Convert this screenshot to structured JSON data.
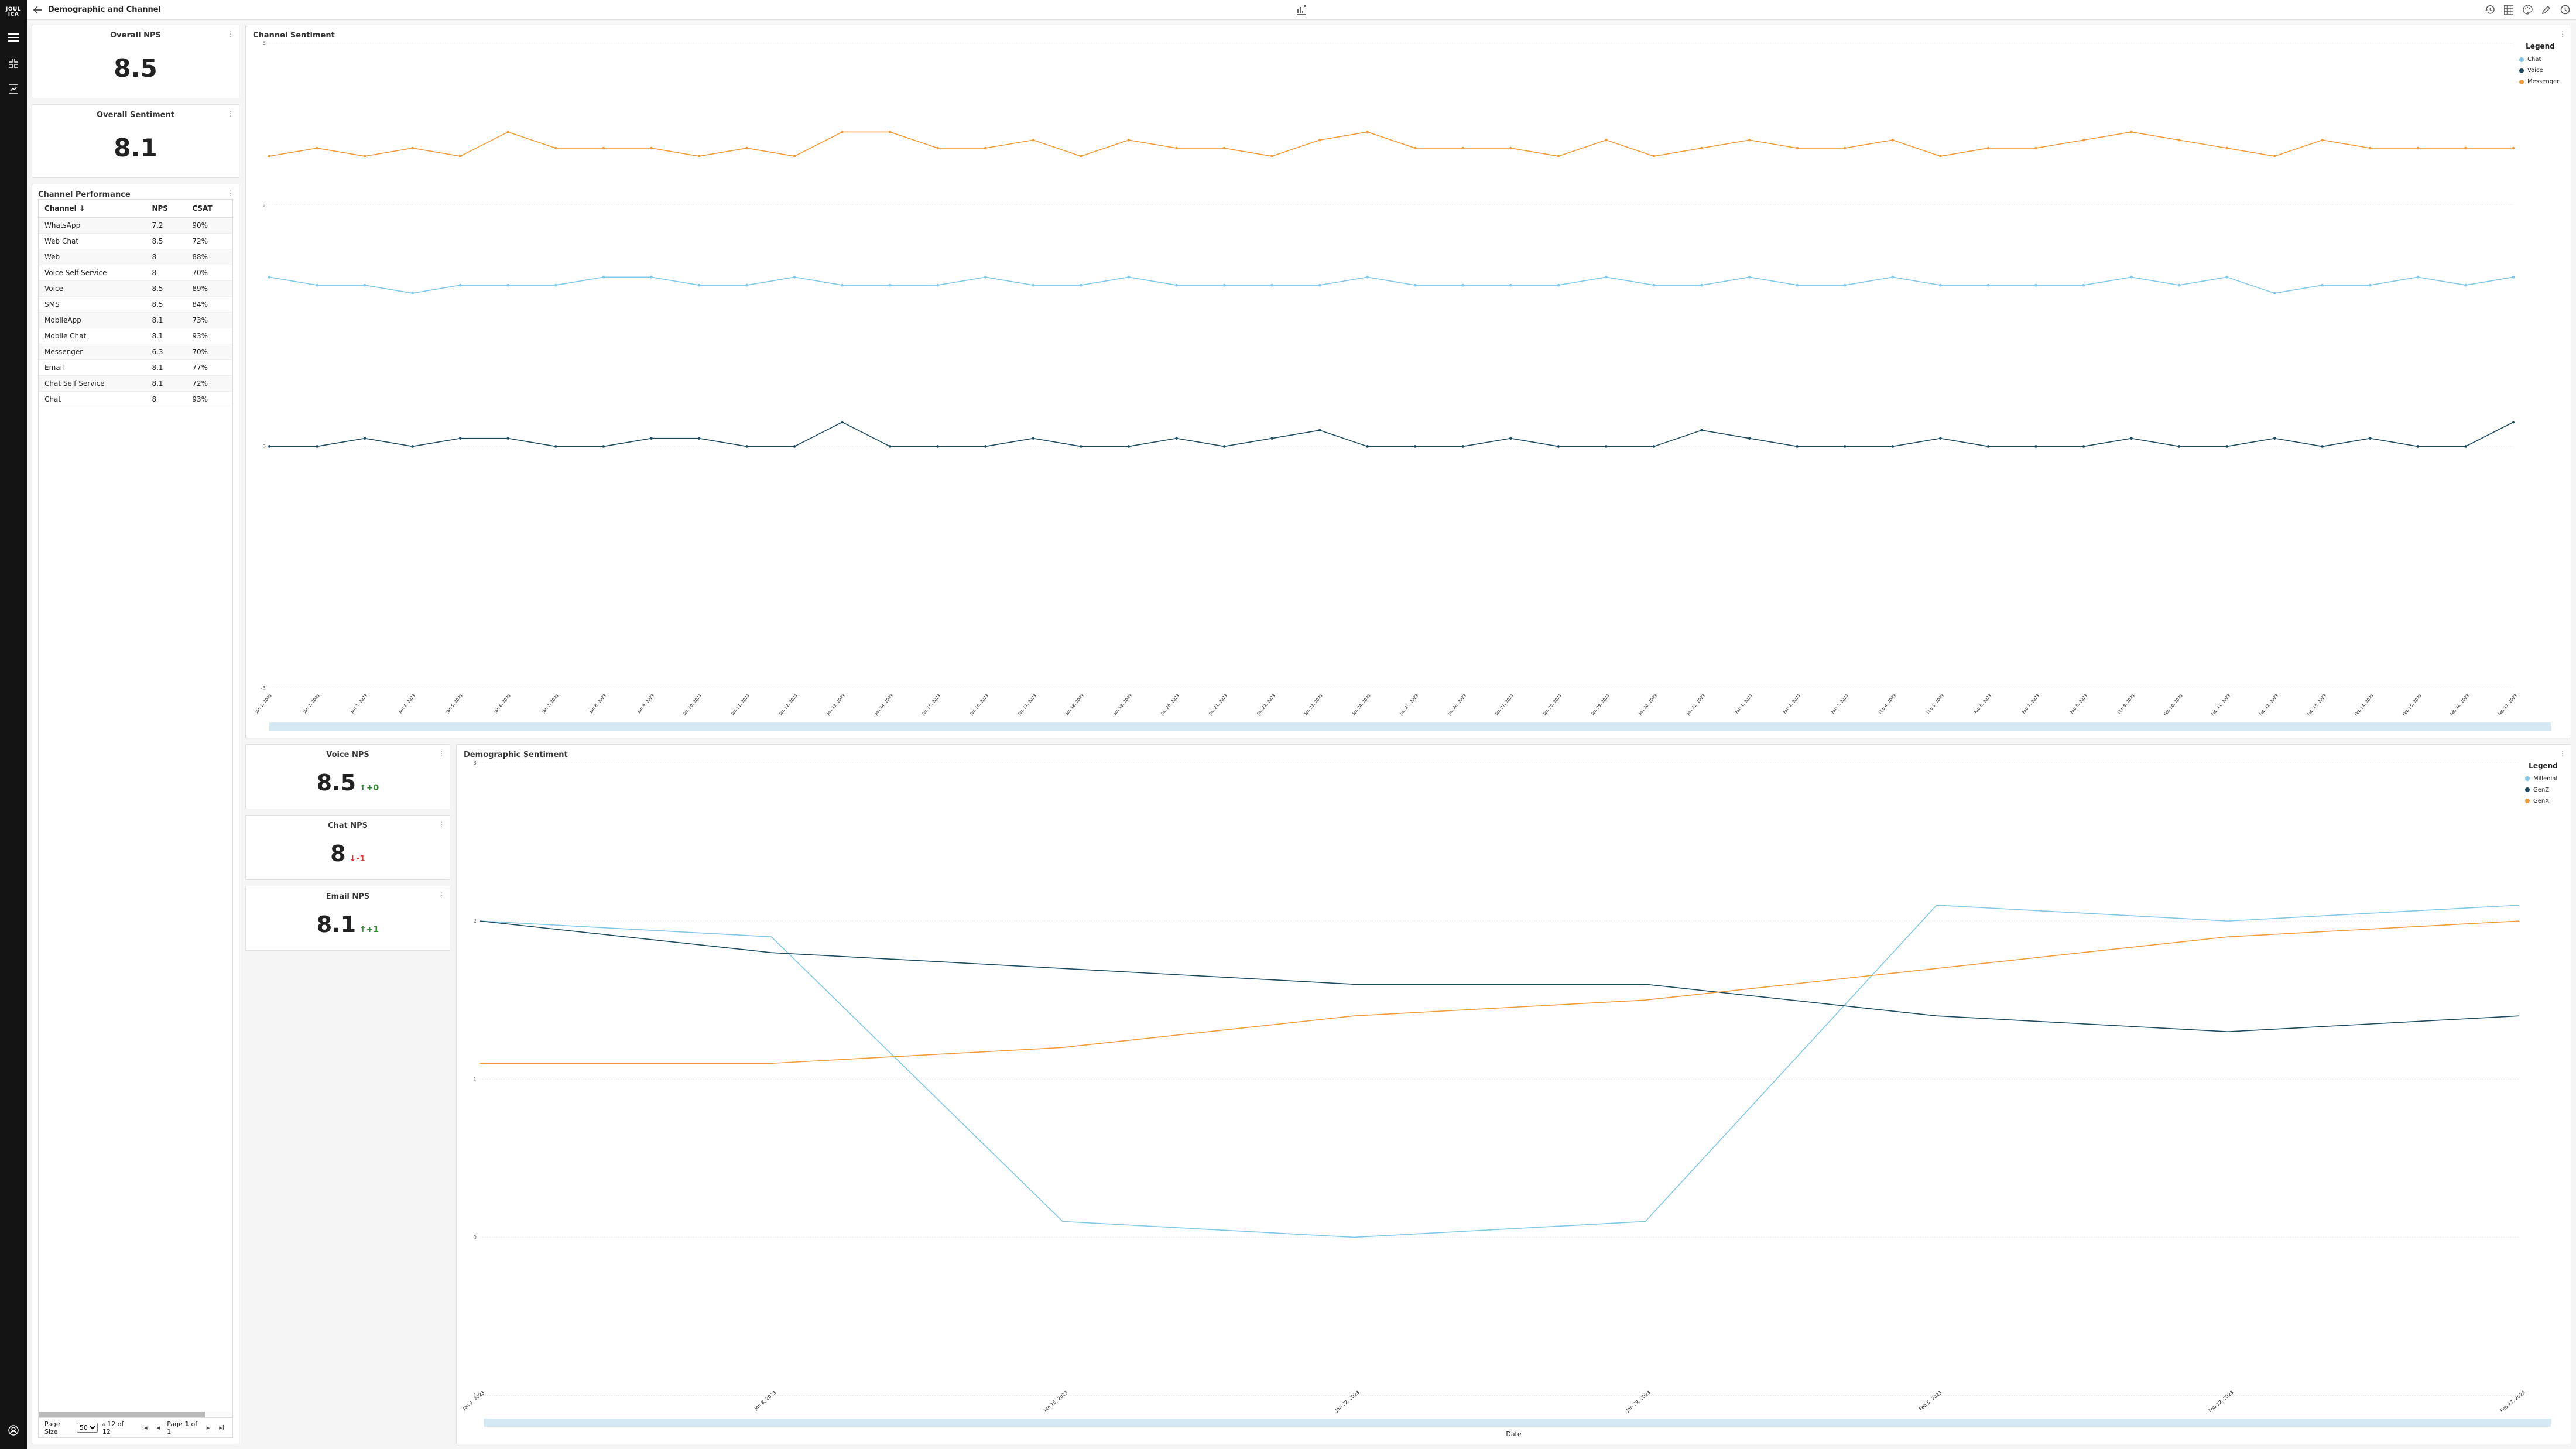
{
  "brand": "JOUL ICA",
  "header": {
    "title": "Demographic and Channel"
  },
  "overall_nps": {
    "title": "Overall NPS",
    "value": "8.5"
  },
  "overall_sentiment": {
    "title": "Overall Sentiment",
    "value": "8.1"
  },
  "channel_perf": {
    "title": "Channel Performance",
    "columns": {
      "c0": "Channel",
      "c1": "NPS",
      "c2": "CSAT"
    },
    "rows": [
      {
        "channel": "WhatsApp",
        "nps": "7.2",
        "csat": "90%"
      },
      {
        "channel": "Web Chat",
        "nps": "8.5",
        "csat": "72%"
      },
      {
        "channel": "Web",
        "nps": "8",
        "csat": "88%"
      },
      {
        "channel": "Voice Self Service",
        "nps": "8",
        "csat": "70%"
      },
      {
        "channel": "Voice",
        "nps": "8.5",
        "csat": "89%"
      },
      {
        "channel": "SMS",
        "nps": "8.5",
        "csat": "84%"
      },
      {
        "channel": "MobileApp",
        "nps": "8.1",
        "csat": "73%"
      },
      {
        "channel": "Mobile Chat",
        "nps": "8.1",
        "csat": "93%"
      },
      {
        "channel": "Messenger",
        "nps": "6.3",
        "csat": "70%"
      },
      {
        "channel": "Email",
        "nps": "8.1",
        "csat": "77%"
      },
      {
        "channel": "Chat Self Service",
        "nps": "8.1",
        "csat": "72%"
      },
      {
        "channel": "Chat",
        "nps": "8",
        "csat": "93%"
      }
    ],
    "pager": {
      "label": "Page Size",
      "pagesize": "50",
      "count": "12 of 12",
      "pageinfo": "Page 1 of 1"
    }
  },
  "channel_sentiment": {
    "title": "Channel Sentiment",
    "legend_title": "Legend",
    "legend": {
      "chat": "Chat",
      "voice": "Voice",
      "messenger": "Messenger"
    }
  },
  "voice_nps": {
    "title": "Voice NPS",
    "value": "8.5",
    "delta": "+0"
  },
  "chat_nps": {
    "title": "Chat NPS",
    "value": "8",
    "delta": "-1"
  },
  "email_nps": {
    "title": "Email NPS",
    "value": "8.1",
    "delta": "+1"
  },
  "demo_sentiment": {
    "title": "Demographic Sentiment",
    "legend_title": "Legend",
    "legend": {
      "millenial": "Millenial",
      "genz": "GenZ",
      "genx": "GenX"
    },
    "xlabel": "Date"
  },
  "chart_data": [
    {
      "id": "channel_sentiment",
      "type": "line",
      "title": "Channel Sentiment",
      "ylabel": "",
      "xlabel": "",
      "ylim": [
        -3,
        5
      ],
      "yticks": [
        -3,
        0,
        3,
        5
      ],
      "x": [
        "Jan 1, 2023",
        "Jan 2, 2023",
        "Jan 3, 2023",
        "Jan 4, 2023",
        "Jan 5, 2023",
        "Jan 6, 2023",
        "Jan 7, 2023",
        "Jan 8, 2023",
        "Jan 9, 2023",
        "Jan 10, 2023",
        "Jan 11, 2023",
        "Jan 12, 2023",
        "Jan 13, 2023",
        "Jan 14, 2023",
        "Jan 15, 2023",
        "Jan 16, 2023",
        "Jan 17, 2023",
        "Jan 18, 2023",
        "Jan 19, 2023",
        "Jan 20, 2023",
        "Jan 21, 2023",
        "Jan 22, 2023",
        "Jan 23, 2023",
        "Jan 24, 2023",
        "Jan 25, 2023",
        "Jan 26, 2023",
        "Jan 27, 2023",
        "Jan 28, 2023",
        "Jan 29, 2023",
        "Jan 30, 2023",
        "Jan 31, 2023",
        "Feb 1, 2023",
        "Feb 2, 2023",
        "Feb 3, 2023",
        "Feb 4, 2023",
        "Feb 5, 2023",
        "Feb 6, 2023",
        "Feb 7, 2023",
        "Feb 8, 2023",
        "Feb 9, 2023",
        "Feb 10, 2023",
        "Feb 11, 2023",
        "Feb 12, 2023",
        "Feb 13, 2023",
        "Feb 14, 2023",
        "Feb 15, 2023",
        "Feb 16, 2023",
        "Feb 17, 2023"
      ],
      "series": [
        {
          "name": "Messenger",
          "color": "#f19a36",
          "values": [
            3.6,
            3.7,
            3.6,
            3.7,
            3.6,
            3.9,
            3.7,
            3.7,
            3.7,
            3.6,
            3.7,
            3.6,
            3.9,
            3.9,
            3.7,
            3.7,
            3.8,
            3.6,
            3.8,
            3.7,
            3.7,
            3.6,
            3.8,
            3.9,
            3.7,
            3.7,
            3.7,
            3.6,
            3.8,
            3.6,
            3.7,
            3.8,
            3.7,
            3.7,
            3.8,
            3.6,
            3.7,
            3.7,
            3.8,
            3.9,
            3.8,
            3.7,
            3.6,
            3.8,
            3.7,
            3.7,
            3.7,
            3.7
          ]
        },
        {
          "name": "Chat",
          "color": "#7dc7e8",
          "values": [
            2.1,
            2.0,
            2.0,
            1.9,
            2.0,
            2.0,
            2.0,
            2.1,
            2.1,
            2.0,
            2.0,
            2.1,
            2.0,
            2.0,
            2.0,
            2.1,
            2.0,
            2.0,
            2.1,
            2.0,
            2.0,
            2.0,
            2.0,
            2.1,
            2.0,
            2.0,
            2.0,
            2.0,
            2.1,
            2.0,
            2.0,
            2.1,
            2.0,
            2.0,
            2.1,
            2.0,
            2.0,
            2.0,
            2.0,
            2.1,
            2.0,
            2.1,
            1.9,
            2.0,
            2.0,
            2.1,
            2.0,
            2.1
          ]
        },
        {
          "name": "Voice",
          "color": "#1a4a5f",
          "values": [
            0.0,
            0.0,
            0.1,
            0.0,
            0.1,
            0.1,
            0.0,
            0.0,
            0.1,
            0.1,
            0.0,
            0.0,
            0.3,
            0.0,
            0.0,
            0.0,
            0.1,
            0.0,
            0.0,
            0.1,
            0.0,
            0.1,
            0.2,
            0.0,
            0.0,
            0.0,
            0.1,
            0.0,
            0.0,
            0.0,
            0.2,
            0.1,
            0.0,
            0.0,
            0.0,
            0.1,
            0.0,
            0.0,
            0.0,
            0.1,
            0.0,
            0.0,
            0.1,
            0.0,
            0.1,
            0.0,
            0.0,
            0.3
          ]
        }
      ]
    },
    {
      "id": "demographic_sentiment",
      "type": "line",
      "title": "Demographic Sentiment",
      "xlabel": "Date",
      "ylim": [
        -1,
        3
      ],
      "yticks": [
        -1,
        0,
        1,
        2,
        3
      ],
      "x": [
        "Jan 1, 2023",
        "Jan 8, 2023",
        "Jan 15, 2023",
        "Jan 22, 2023",
        "Jan 29, 2023",
        "Feb 5, 2023",
        "Feb 12, 2023",
        "Feb 17, 2023"
      ],
      "series": [
        {
          "name": "Millenial",
          "color": "#7dc7e8",
          "values": [
            2.0,
            1.9,
            0.1,
            0.0,
            0.1,
            2.1,
            2.0,
            2.1
          ]
        },
        {
          "name": "GenZ",
          "color": "#1a4a5f",
          "values": [
            2.0,
            1.8,
            1.7,
            1.6,
            1.6,
            1.4,
            1.3,
            1.4
          ]
        },
        {
          "name": "GenX",
          "color": "#f19a36",
          "values": [
            1.1,
            1.1,
            1.2,
            1.4,
            1.5,
            1.7,
            1.9,
            2.0
          ]
        }
      ]
    }
  ]
}
